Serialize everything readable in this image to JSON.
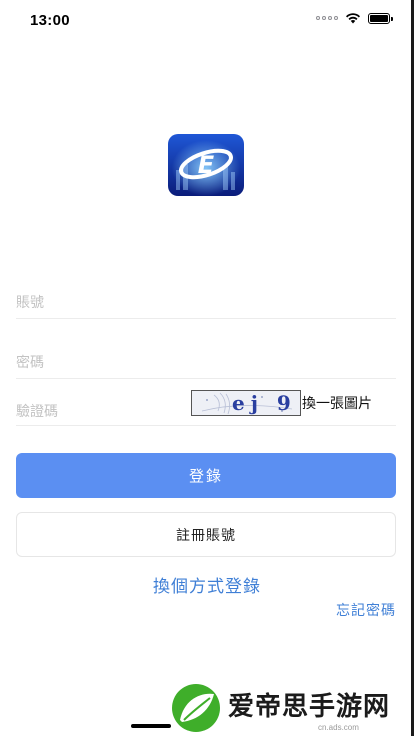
{
  "status_bar": {
    "time": "13:00"
  },
  "app": {
    "logo_icon": "app-logo-icon"
  },
  "form": {
    "account_placeholder": "賬號",
    "password_placeholder": "密碼",
    "captcha_placeholder": "驗證碼",
    "captcha_image_text": "ej 9",
    "refresh_captcha_label": "換一張圖片"
  },
  "buttons": {
    "login_label": "登錄",
    "register_label": "註冊賬號",
    "switch_login_label": "換個方式登錄",
    "forgot_password_label": "忘記密碼"
  },
  "watermark": {
    "text": "爱帝思手游网",
    "url": "cn.ads.com"
  },
  "colors": {
    "primary": "#5b8ff2",
    "link": "#3f7fd6",
    "watermark_green": "#3fae2a"
  }
}
